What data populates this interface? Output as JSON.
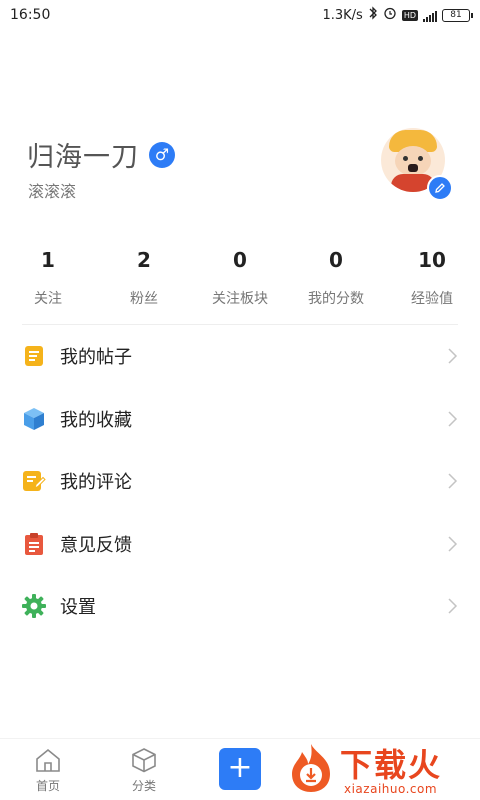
{
  "status_bar": {
    "time": "16:50",
    "net_speed": "1.3K/s",
    "battery": "81"
  },
  "profile": {
    "name": "归海一刀",
    "gender_symbol": "♂",
    "subtitle": "滚滚滚"
  },
  "stats": [
    {
      "value": "1",
      "label": "关注"
    },
    {
      "value": "2",
      "label": "粉丝"
    },
    {
      "value": "0",
      "label": "关注板块"
    },
    {
      "value": "0",
      "label": "我的分数"
    },
    {
      "value": "10",
      "label": "经验值"
    }
  ],
  "menu": [
    {
      "label": "我的帖子",
      "icon": "document-icon",
      "color": "#f5b31b"
    },
    {
      "label": "我的收藏",
      "icon": "box-icon",
      "color": "#4a9ee8"
    },
    {
      "label": "我的评论",
      "icon": "comment-edit-icon",
      "color": "#f5b31b"
    },
    {
      "label": "意见反馈",
      "icon": "clipboard-icon",
      "color": "#e8583e"
    },
    {
      "label": "设置",
      "icon": "gear-icon",
      "color": "#3fb15a"
    }
  ],
  "bottom_nav": {
    "home": "首页",
    "category": "分类",
    "add_symbol": "+"
  },
  "watermark": {
    "title": "下载火",
    "subtitle": "xiazaihuo.com"
  },
  "colors": {
    "accent": "#2d7cf6",
    "watermark": "#e8461e"
  }
}
